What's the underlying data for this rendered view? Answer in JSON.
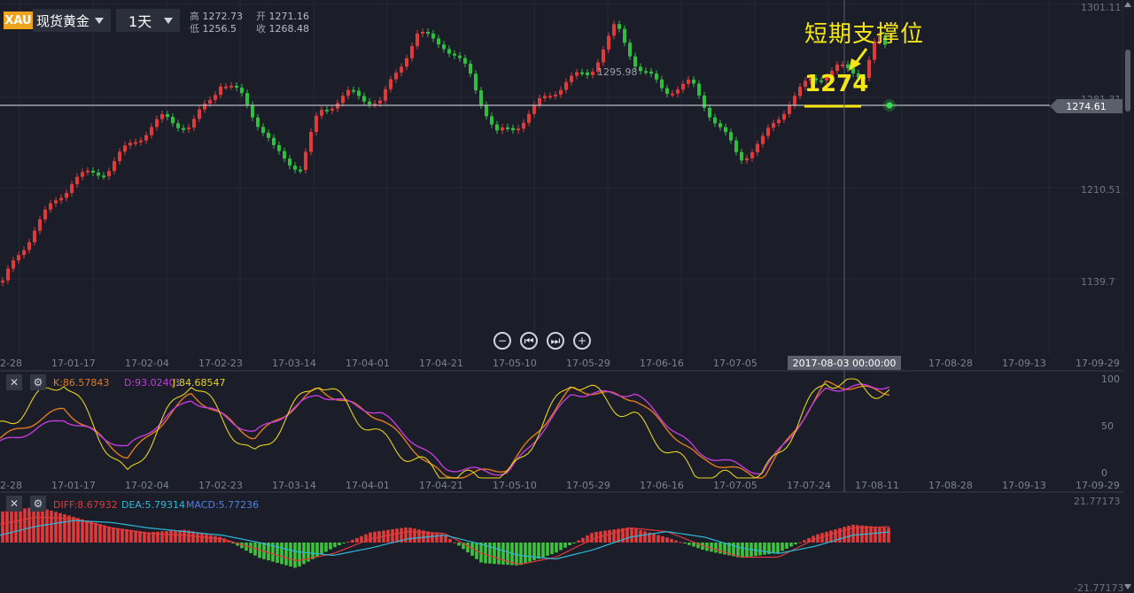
{
  "header": {
    "symbol_badge": "XAU",
    "symbol_name": "现货黄金",
    "period": "1天",
    "high_label": "高",
    "high_value": "1272.73",
    "low_label": "低",
    "low_value": "1256.5",
    "open_label": "开",
    "open_value": "1271.16",
    "close_label": "收",
    "close_value": "1268.48"
  },
  "annotation": {
    "title": "短期支撑位",
    "value": "1274",
    "color": "#f5e614"
  },
  "price_chart": {
    "current_price": "1274.61",
    "high_marker": "1295.98",
    "y_axis_labels": [
      "1301.11",
      "1281.31",
      "1210.51",
      "1139.7"
    ],
    "crosshair_date": "2017-08-03 00:00:00",
    "x_axis_labels": [
      "2-28",
      "17-01-17",
      "17-02-04",
      "17-02-23",
      "17-03-14",
      "17-04-01",
      "17-04-21",
      "17-05-10",
      "17-05-29",
      "17-06-16",
      "17-07-05",
      "17-07-24",
      "17-08-11",
      "17-08-28",
      "17-09-13",
      "17-09-29"
    ],
    "up_color": "#e03a3a",
    "down_color": "#2fbf3f"
  },
  "navigation": {
    "zoom_out": "−",
    "prev": "⏮",
    "next": "⏭",
    "zoom_in": "+"
  },
  "kdj": {
    "k_label": "K:86.57843",
    "d_label": "D:93.02401",
    "j_label": "J:84.68547",
    "y_axis_labels": [
      "100",
      "50",
      "0"
    ],
    "x_axis_labels": [
      "2-28",
      "17-01-17",
      "17-02-04",
      "17-02-23",
      "17-03-14",
      "17-04-01",
      "17-04-21",
      "17-05-10",
      "17-05-29",
      "17-06-16",
      "17-07-05",
      "17-07-24",
      "17-08-11",
      "17-08-28",
      "17-09-13",
      "17-09-29"
    ],
    "k_color": "#e07b1e",
    "d_color": "#c23bd8",
    "j_color": "#e6d21e"
  },
  "macd": {
    "diff_label": "DIFF:8.67932",
    "dea_label": "DEA:5.79314",
    "macd_label": "MACD:5.77236",
    "y_axis_top": "21.77173",
    "y_axis_bottom": "-21.77173",
    "diff_color": "#e03a3a",
    "dea_color": "#2fb7d8",
    "macd_color": "#4f7fe0"
  },
  "chart_data": [
    {
      "type": "line",
      "title": "",
      "description": "XAU daily close (approximate, read from candlesticks)",
      "x": [
        "2016-12-28",
        "2017-01-17",
        "2017-02-04",
        "2017-02-23",
        "2017-03-14",
        "2017-04-01",
        "2017-04-21",
        "2017-05-10",
        "2017-05-29",
        "2017-06-16",
        "2017-07-05",
        "2017-07-24",
        "2017-08-03",
        "2017-08-11"
      ],
      "values": [
        1139,
        1200,
        1220,
        1257,
        1200,
        1250,
        1284,
        1220,
        1265,
        1256,
        1220,
        1255,
        1270,
        1274
      ],
      "annotations": [
        "1295.98",
        "1274.61"
      ],
      "ylim": [
        1139.7,
        1301.11
      ]
    },
    {
      "type": "line",
      "title": "",
      "series": [
        {
          "name": "K",
          "values": [
            40,
            70,
            20,
            85,
            40,
            90,
            60,
            0,
            10,
            90,
            80,
            20,
            0,
            95,
            86.58
          ]
        },
        {
          "name": "D",
          "values": [
            35,
            60,
            30,
            80,
            45,
            85,
            65,
            10,
            5,
            85,
            85,
            25,
            5,
            90,
            93.02
          ]
        },
        {
          "name": "J",
          "values": [
            50,
            100,
            0,
            100,
            20,
            100,
            40,
            0,
            0,
            100,
            60,
            0,
            0,
            100,
            84.69
          ]
        }
      ],
      "ylim": [
        0,
        100
      ]
    },
    {
      "type": "bar",
      "title": "",
      "series": [
        {
          "name": "MACD",
          "values": [
            12,
            14,
            10,
            6,
            4,
            5,
            2,
            -6,
            -10,
            -2,
            4,
            6,
            3,
            -8,
            -9,
            -4,
            4,
            6,
            2,
            -3,
            -6,
            -4,
            3,
            7,
            5.77
          ]
        },
        {
          "name": "DIFF",
          "values": [
            10,
            14,
            13,
            8,
            5,
            4,
            2,
            -4,
            -10,
            -6,
            2,
            6,
            5,
            -6,
            -12,
            -8,
            2,
            8,
            6,
            -2,
            -8,
            -8,
            2,
            8,
            8.68
          ]
        },
        {
          "name": "DEA",
          "values": [
            4,
            9,
            12,
            11,
            8,
            6,
            4,
            0,
            -5,
            -7,
            -3,
            2,
            4,
            -1,
            -7,
            -9,
            -4,
            3,
            6,
            3,
            -3,
            -6,
            -2,
            4,
            5.79
          ]
        }
      ],
      "ylim": [
        -21.77173,
        21.77173
      ]
    }
  ]
}
